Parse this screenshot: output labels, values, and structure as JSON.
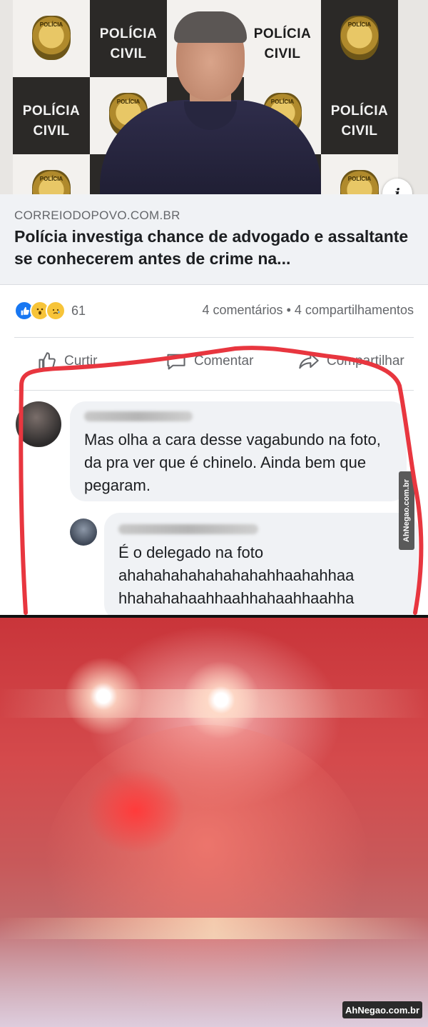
{
  "post": {
    "photo": {
      "backdrop_text_line1": "POLÍCIA",
      "backdrop_text_line2": "CIVIL",
      "badge_label": "POLÍCIA",
      "info_icon": "info-icon"
    },
    "link": {
      "domain": "CORREIODOPOVO.COM.BR",
      "title": "Polícia investiga chance de advogado e assaltante se conhecerem antes de crime na..."
    },
    "reactions": {
      "icons": [
        "like-icon",
        "wow-icon",
        "sad-icon"
      ],
      "count": "61",
      "comments": "4 comentários",
      "separator": "•",
      "shares": "4 compartilhamentos"
    },
    "actions": {
      "like": "Curtir",
      "comment": "Comentar",
      "share": "Compartilhar"
    },
    "comments": [
      {
        "text": "Mas olha a cara desse vagabundo na foto, da pra ver que é chinelo. Ainda bem que pegaram."
      },
      {
        "text": "É o delegado na foto\nahahahahahahahahahhaahahhaa\nhhahahahaahhaahhahaahhaahha\nahh"
      }
    ]
  },
  "watermarks": {
    "side": "AhNegao.com.br",
    "bottom": "AhNegao.com.br"
  },
  "colors": {
    "facebook_blue": "#1877f2",
    "outline_red": "#e8363f",
    "meta_gray": "#65676b"
  }
}
